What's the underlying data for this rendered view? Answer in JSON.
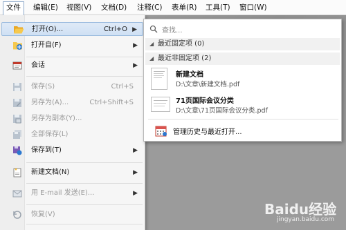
{
  "menubar": {
    "items": [
      {
        "label": "文件"
      },
      {
        "label": "编辑(E)"
      },
      {
        "label": "视图(V)"
      },
      {
        "label": "文档(D)"
      },
      {
        "label": "注释(C)"
      },
      {
        "label": "表单(R)"
      },
      {
        "label": "工具(T)"
      },
      {
        "label": "窗口(W)"
      }
    ]
  },
  "file_menu": {
    "items": [
      {
        "label": "打开(O)...",
        "shortcut": "Ctrl+O",
        "submenu": true,
        "icon": "folder-open-icon"
      },
      {
        "label": "打开自(F)",
        "shortcut": "",
        "submenu": true,
        "icon": "open-from-icon"
      },
      {
        "label": "会话",
        "shortcut": "",
        "submenu": true,
        "icon": "session-icon"
      },
      {
        "label": "保存(S)",
        "shortcut": "Ctrl+S",
        "submenu": false,
        "icon": "save-icon"
      },
      {
        "label": "另存为(A)...",
        "shortcut": "Ctrl+Shift+S",
        "submenu": false,
        "icon": "save-as-icon"
      },
      {
        "label": "另存为副本(Y)...",
        "shortcut": "",
        "submenu": false,
        "icon": "save-copy-icon"
      },
      {
        "label": "全部保存(L)",
        "shortcut": "",
        "submenu": false,
        "icon": "save-all-icon"
      },
      {
        "label": "保存到(T)",
        "shortcut": "",
        "submenu": true,
        "icon": "save-to-icon"
      },
      {
        "label": "新建文档(N)",
        "shortcut": "",
        "submenu": true,
        "icon": "new-document-icon"
      },
      {
        "label": "用 E-mail 发送(E)...",
        "shortcut": "",
        "submenu": true,
        "icon": "email-icon"
      },
      {
        "label": "恢复(V)",
        "shortcut": "",
        "submenu": false,
        "icon": "revert-icon"
      }
    ]
  },
  "recent_menu": {
    "search_placeholder": "查找...",
    "pinned_group": "最近固定项 (0)",
    "unpinned_group": "最近非固定项 (2)",
    "files": [
      {
        "title": "新建文档",
        "path": "D:\\文章\\新建文档.pdf"
      },
      {
        "title": "71页国际会议分类",
        "path": "D:\\文章\\71页国际会议分类.pdf"
      }
    ],
    "manage_label": "管理历史与最近打开..."
  },
  "watermark": {
    "brand": "Baidu经验",
    "url": "jingyan.baidu.com"
  },
  "colors": {
    "hover": "#cfe0f4",
    "accent_blue": "#2b6cc4",
    "folder": "#f2b638"
  }
}
